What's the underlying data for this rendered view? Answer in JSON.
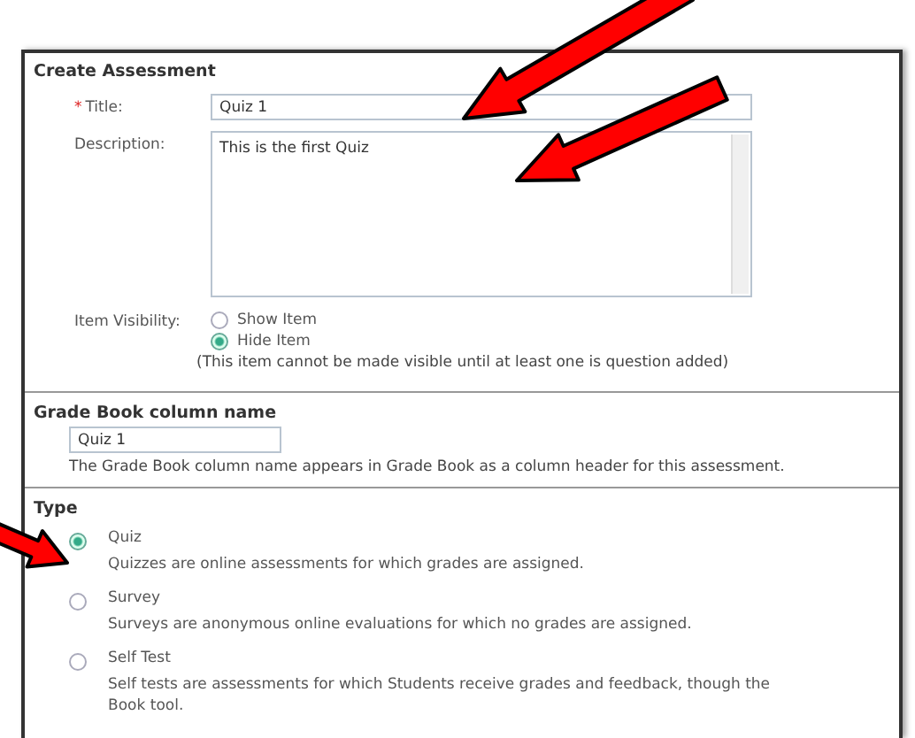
{
  "panel": {
    "title": "Create Assessment"
  },
  "fields": [
    {
      "kind": "text",
      "label": "Title:",
      "required": true,
      "required_mark": "*",
      "value": "Quiz 1"
    },
    {
      "kind": "textarea",
      "label": "Description:",
      "required": false,
      "value": "This is the first Quiz"
    }
  ],
  "visibility": {
    "label": "Item Visibility:",
    "options": [
      {
        "label": "Show Item",
        "selected": false
      },
      {
        "label": "Hide Item",
        "selected": true
      }
    ],
    "note": "(This item cannot be made visible until at least one is question added)"
  },
  "gradebook": {
    "title": "Grade Book column name",
    "value": "Quiz 1",
    "help": "The Grade Book column name appears in Grade Book as a column header for this assessment."
  },
  "type": {
    "title": "Type",
    "options": [
      {
        "label": "Quiz",
        "description": "Quizzes are online assessments for which grades are assigned.",
        "selected": true
      },
      {
        "label": "Survey",
        "description": "Surveys are anonymous online evaluations for which no grades are assigned.",
        "selected": false
      },
      {
        "label": "Self Test",
        "description": "Self tests are assessments for which Students receive grades and feedback, though the\nBook tool.",
        "selected": false
      }
    ]
  }
}
